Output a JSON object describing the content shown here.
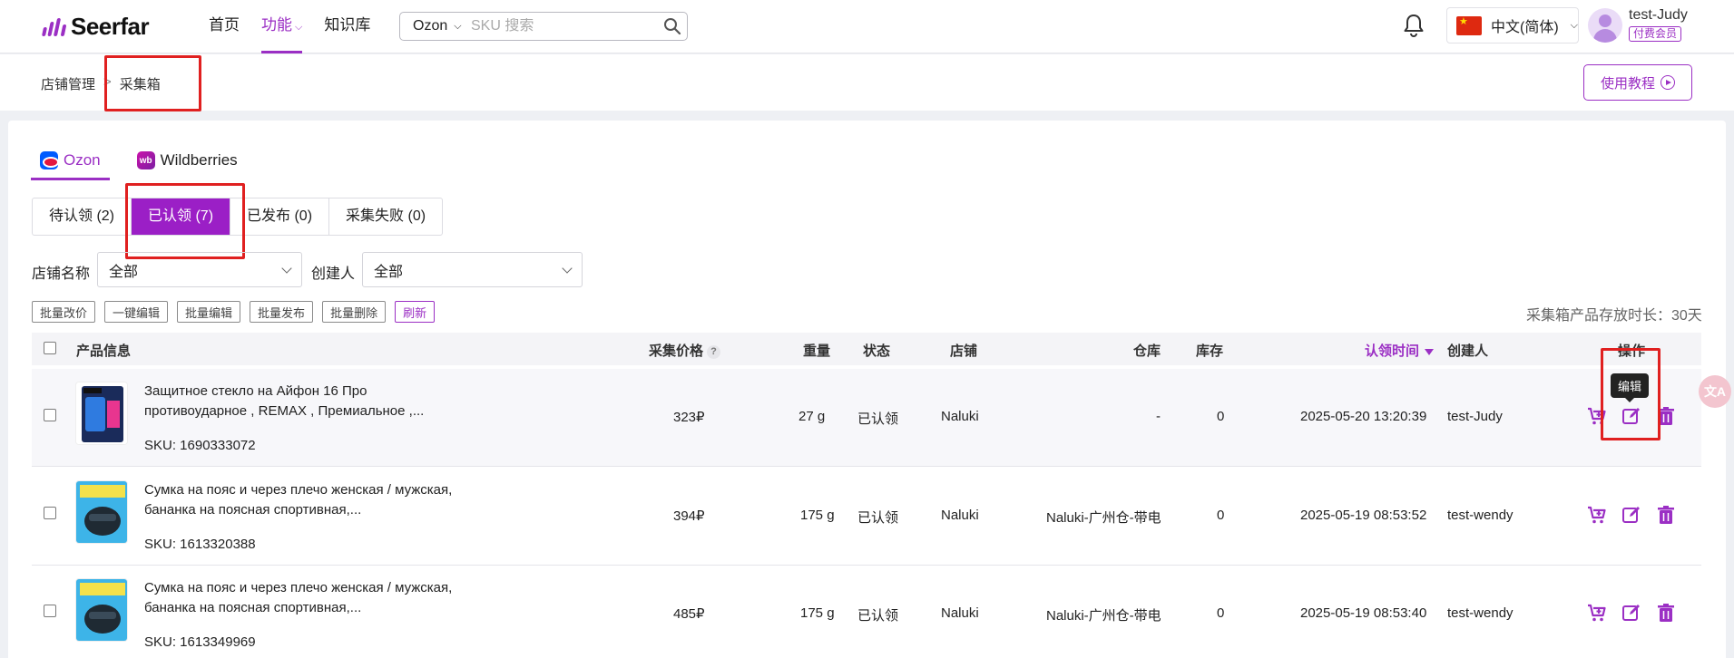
{
  "nav": {
    "logo": "Seerfar",
    "links": [
      {
        "label": "首页"
      },
      {
        "label": "功能"
      },
      {
        "label": "知识库"
      }
    ],
    "search": {
      "platform": "Ozon",
      "placeholder": "SKU 搜索"
    },
    "language": "中文(简体)",
    "user": {
      "name": "test-Judy",
      "badge": "付费会员"
    }
  },
  "breadcrumb": {
    "parent": "店铺管理",
    "separator": ">",
    "current": "采集箱"
  },
  "tutorial_label": "使用教程",
  "platform_tabs": [
    {
      "label": "Ozon",
      "active": true
    },
    {
      "label": "Wildberries",
      "active": false
    }
  ],
  "status_tabs": [
    {
      "label": "待认领 (2)"
    },
    {
      "label": "已认领 (7)"
    },
    {
      "label": "已发布 (0)"
    },
    {
      "label": "采集失败 (0)"
    }
  ],
  "filters": {
    "store_label": "店铺名称",
    "store_value": "全部",
    "creator_label": "创建人",
    "creator_value": "全部"
  },
  "bulk_actions": [
    "批量改价",
    "一键编辑",
    "批量编辑",
    "批量发布",
    "批量删除",
    "刷新"
  ],
  "storage_note": "采集箱产品存放时长：30天",
  "table": {
    "headers": {
      "product": "产品信息",
      "price": "采集价格",
      "weight": "重量",
      "status": "状态",
      "store": "店铺",
      "warehouse": "仓库",
      "stock": "库存",
      "claim_time": "认领时间",
      "creator": "创建人",
      "ops": "操作"
    },
    "rows": [
      {
        "title": "Защитное стекло на Айфон 16 Про противоударное , REMAX , Премиальное ,...",
        "sku": "SKU: 1690333072",
        "price": "323₽",
        "weight": "27 g",
        "status": "已认领",
        "store": "Naluki",
        "warehouse": "-",
        "stock": "0",
        "claim_time": "2025-05-20 13:20:39",
        "creator": "test-Judy"
      },
      {
        "title": "Сумка на пояс и через плечо женская / мужская, бананка на поясная спортивная,...",
        "sku": "SKU: 1613320388",
        "price": "394₽",
        "weight": "175 g",
        "status": "已认领",
        "store": "Naluki",
        "warehouse": "Naluki-广州仓-带电",
        "stock": "0",
        "claim_time": "2025-05-19 08:53:52",
        "creator": "test-wendy"
      },
      {
        "title": "Сумка на пояс и через плечо женская / мужская, бананка на поясная спортивная,...",
        "sku": "SKU: 1613349969",
        "price": "485₽",
        "weight": "175 g",
        "status": "已认领",
        "store": "Naluki",
        "warehouse": "Naluki-广州仓-带电",
        "stock": "0",
        "claim_time": "2025-05-19 08:53:40",
        "creator": "test-wendy"
      }
    ]
  },
  "tooltip": "编辑",
  "help_glyph": "?",
  "translate_glyph": "文A",
  "accent_color": "#9b2fc4",
  "highlight_color": "#e02020"
}
